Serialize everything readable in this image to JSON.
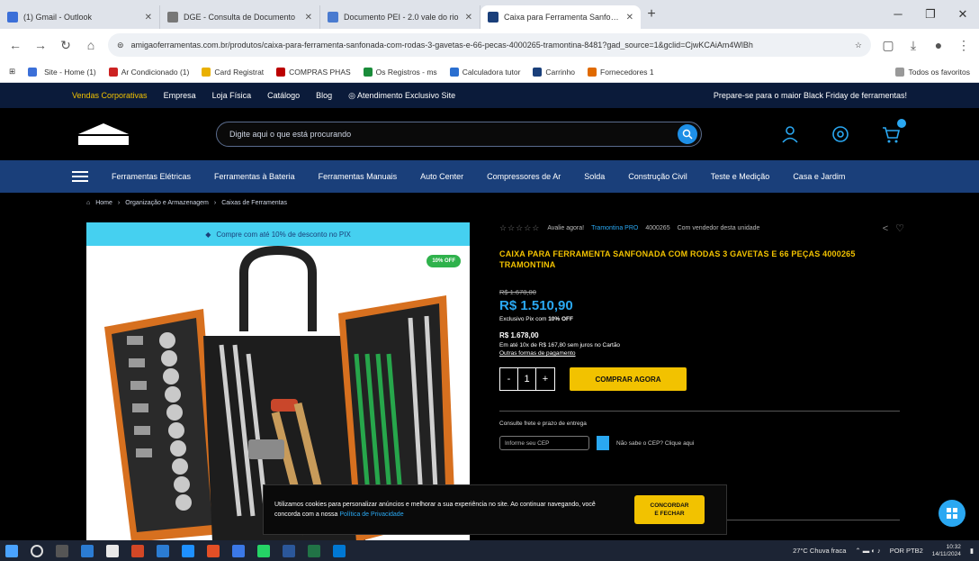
{
  "browser": {
    "tabs": [
      {
        "title": "(1) Gmail - Outlook",
        "active": false
      },
      {
        "title": "DGE - Consulta de Documento",
        "active": false
      },
      {
        "title": "Documento PEI - 2.0 vale do rio",
        "active": false
      },
      {
        "title": "Caixa para Ferramenta Sanfonada",
        "active": true
      }
    ],
    "new_tab": "+",
    "url": "amigaoferramentas.com.br/produtos/caixa-para-ferramenta-sanfonada-com-rodas-3-gavetas-e-66-pecas-4000265-tramontina-8481?gad_source=1&gclid=CjwKCAiAm4WlBh",
    "bookmarks": [
      "Site - Home (1)",
      "Ar Condicionado (1)",
      "Card Registrat",
      "COMPRAS PHAS",
      "Os Registros - ms",
      "Calculadora tutor",
      "Carrinho",
      "Fornecedores 1",
      "Todos os favoritos"
    ]
  },
  "site": {
    "topstrip": {
      "links": [
        "Vendas Corporativas",
        "Empresa",
        "Loja Física",
        "Catálogo",
        "Blog",
        "Atendimento Exclusivo Site"
      ],
      "promo": "Prepare-se para o maior Black Friday de ferramentas!"
    },
    "search": {
      "placeholder": "Digite aqui o que está procurando"
    },
    "categories": [
      "Ferramentas Elétricas",
      "Ferramentas à Bateria",
      "Ferramentas Manuais",
      "Auto Center",
      "Compressores de Ar",
      "Solda",
      "Construção Civil",
      "Teste e Medição",
      "Casa e Jardim"
    ],
    "breadcrumb": [
      "Home",
      "Organização e Armazenagem",
      "Caixas de Ferramentas"
    ],
    "gallery": {
      "banner": "Compre com até 10% de desconto no PIX",
      "discount_badge": "10% OFF"
    },
    "product": {
      "rating_text": "Avalie agora!",
      "brand_link": "Tramontina PRO",
      "sku": "4000265",
      "stock": "Com vendedor desta unidade",
      "title": "CAIXA PARA FERRAMENTA SANFONADA COM RODAS 3 GAVETAS E 66 PEÇAS 4000265 TRAMONTINA",
      "old_price": "R$ 1.678,00",
      "price": "R$ 1.510,90",
      "pix_text": "Exclusivo Pix com",
      "pix_discount": "10% OFF",
      "installment_price": "R$ 1.678,00",
      "installment_text": "Em até 10x de R$ 167,80 sem juros no Cartão",
      "installment_link": "Outras formas de pagamento",
      "qty_minus": "-",
      "qty_value": "1",
      "qty_plus": "+",
      "buy_label": "COMPRAR AGORA",
      "ship_label": "Consulte frete e prazo de entrega",
      "ship_placeholder": "Informe seu CEP",
      "ship_link": "Não sabe o CEP? Clique aqui"
    },
    "cookie": {
      "text": "Utilizamos cookies para personalizar anúncios e melhorar a sua experiência no site. Ao continuar navegando, você concorda com a nossa",
      "link": "Política de Privacidade",
      "btn_line1": "CONCORDAR",
      "btn_line2": "E FECHAR"
    }
  },
  "taskbar": {
    "weather": "27°C Chuva fraca",
    "time": "10:32",
    "date": "14/11/2024",
    "lang": "POR PTB2"
  },
  "colors": {
    "accent_blue": "#2aa8f2",
    "accent_yellow": "#f2c200",
    "nav_blue": "#1a3f7a",
    "topstrip": "#0b1b3a"
  }
}
